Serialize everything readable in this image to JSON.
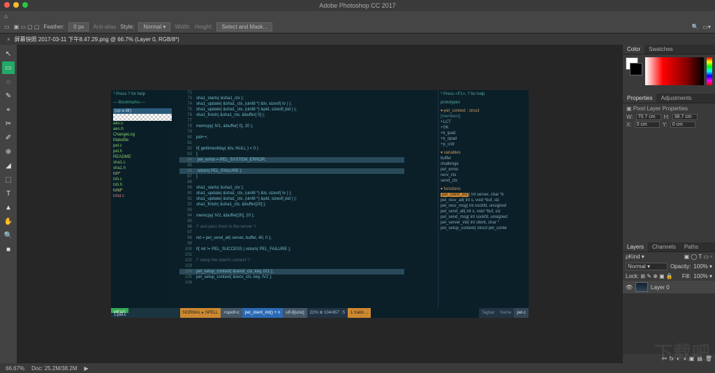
{
  "titlebar": {
    "title": "Adobe Photoshop CC 2017"
  },
  "mac_dots": [
    "#ff5f57",
    "#febc2e",
    "#28c840"
  ],
  "menubar": {
    "items": [
      "▣",
      "▭",
      "⊞",
      "⊡"
    ],
    "feather_label": "Feather:",
    "feather_value": "0 px",
    "antialias": "Anti-alias",
    "style_label": "Style:",
    "style_value": "Normal ▾",
    "width_label": "Width:",
    "height_label": "Height:",
    "select_mask": "Select and Mask..."
  },
  "tab": {
    "close": "×",
    "title": "屏幕快照 2017-03-11 下午8.47.29.png @ 66.7% (Layer 0, RGB/8*)"
  },
  "tools": [
    "↖",
    "▭",
    "◌",
    "✎",
    "⌖",
    "✂",
    "✐",
    "⊕",
    "◢",
    "⬚",
    "T",
    "▲",
    "✋",
    "🔍",
    "■"
  ],
  "editor": {
    "help": "* Press ? for help",
    "bookmarks": "----Bookmarks----",
    "up_dir": "(up a dir)",
    "files": [
      {
        "n": "aes.c",
        "c": "file"
      },
      {
        "n": "aes.h",
        "c": "file"
      },
      {
        "n": "ChangeLog",
        "c": "file"
      },
      {
        "n": "Makefile",
        "c": "file"
      },
      {
        "n": "pel.c",
        "c": "file"
      },
      {
        "n": "pel.h",
        "c": "file"
      },
      {
        "n": "README",
        "c": "file"
      },
      {
        "n": "sha1.c",
        "c": "file"
      },
      {
        "n": "sha1.h",
        "c": "file"
      },
      {
        "n": "tsh*",
        "c": "fy"
      },
      {
        "n": "tsh.c",
        "c": "file"
      },
      {
        "n": "tsh.h",
        "c": "file"
      },
      {
        "n": "tshd*",
        "c": "fy"
      },
      {
        "n": "tshd.c",
        "c": "fr"
      }
    ],
    "code": [
      {
        "ln": 71,
        "t": ""
      },
      {
        "ln": 73,
        "t": "sha1_starts( &sha1_ctx );"
      },
      {
        "ln": 74,
        "t": "sha1_update( &sha1_ctx, (uint8 *) &tv, sizeof( tv ) );"
      },
      {
        "ln": 75,
        "t": "sha1_update( &sha1_ctx, (uint8 *) &pid, sizeof( pid ) );"
      },
      {
        "ln": 76,
        "t": "sha1_finish( &sha1_ctx, &buffer[ 0] );"
      },
      {
        "ln": 77,
        "t": ""
      },
      {
        "ln": 78,
        "t": "memcpy( IV1, &buffer[ 0], 20 );"
      },
      {
        "ln": 79,
        "t": ""
      },
      {
        "ln": 80,
        "t": "pid++;"
      },
      {
        "ln": 81,
        "t": ""
      },
      {
        "ln": 82,
        "t": "if( gettimeofday( &tv, NULL ) < 0 )"
      },
      {
        "ln": 83,
        "t": "{"
      },
      {
        "ln": 84,
        "t": "  pel_errno = PEL_SYSTEM_ERROR;",
        "hl": 1
      },
      {
        "ln": 85,
        "t": ""
      },
      {
        "ln": 86,
        "t": "  return( PEL_FAILURE );",
        "hl": 1
      },
      {
        "ln": 87,
        "t": "}"
      },
      {
        "ln": 88,
        "t": ""
      },
      {
        "ln": 89,
        "t": "sha1_starts( &sha1_ctx );"
      },
      {
        "ln": 90,
        "t": "sha1_update( &sha1_ctx, (uint8 *) &tv, sizeof( tv ) );"
      },
      {
        "ln": 91,
        "t": "sha1_update( &sha1_ctx, (uint8 *) &pid, sizeof( pid ) );"
      },
      {
        "ln": 92,
        "t": "sha1_finish( &sha1_ctx, &buffer[20] );"
      },
      {
        "ln": 93,
        "t": ""
      },
      {
        "ln": 94,
        "t": "memcpy( IV2, &buffer[20], 20 );"
      },
      {
        "ln": 95,
        "t": ""
      },
      {
        "ln": 96,
        "t": "/* and pass them to the server */",
        "cm": 1
      },
      {
        "ln": 97,
        "t": ""
      },
      {
        "ln": 98,
        "t": "ret = pel_send_all( server, buffer, 40, 0 );"
      },
      {
        "ln": 99,
        "t": ""
      },
      {
        "ln": 100,
        "t": "if( ret != PEL_SUCCESS ) return( PEL_FAILURE );"
      },
      {
        "ln": 101,
        "t": ""
      },
      {
        "ln": 102,
        "t": "/* setup the client's context */",
        "cm": 1
      },
      {
        "ln": 103,
        "t": ""
      },
      {
        "ln": 104,
        "t": "pel_setup_context( &send_ctx, key, IV1 );",
        "hl": 1
      },
      {
        "ln": 105,
        "t": "pel_setup_context( &recv_ctx, key, IV2 );"
      },
      {
        "ln": 106,
        "t": ""
      }
    ],
    "right": {
      "help": "* Press <F1>, ? for help",
      "proto": "prototypes",
      "struct_lbl": "▾-pel_context : struct",
      "members": "  [members]",
      "mem_items": [
        "+LCT",
        "+SK",
        "+k_ipad",
        "+k_opad",
        "+p_cntr"
      ],
      "vars": "▾ variables",
      "var_items": [
        "buffer",
        "challenge",
        "pel_errno",
        "recv_ctx",
        "send_ctx"
      ],
      "funcs": "▾ functions",
      "func_sel": "pel_client_init",
      "func_sel_sig": "( int server, char *k",
      "func_items": [
        "pel_recv_all( int s, void *buf, siz",
        "pel_recv_msg( int sockfd, unsigned",
        "pel_send_all( int s, void *buf, siz",
        "pel_send_msg( int sockfd, unsigned",
        "pel_server_init( int client, char *",
        "pel_setup_context( struct pel_conte"
      ]
    },
    "status": {
      "head": "HEAD",
      "mode": "NORMAL ▸ SPELL",
      "git": "<spell>c",
      "fn": "pel_client_init() + n",
      "enc": "utf-8[unix]",
      "pos": "22% ≣ 104/457 : 5",
      "trail": "1 trailin…",
      "taglist": "Tagbar",
      "name": "Name",
      "file": "pel.c",
      "left_label": "1:pel.c"
    }
  },
  "panels": {
    "color_tab": "Color",
    "swatches_tab": "Swatches",
    "fg": "#ffffff",
    "bg": "#000000",
    "properties_tab": "Properties",
    "adjustments_tab": "Adjustments",
    "prop_title": "Pixel Layer Properties",
    "w_label": "W:",
    "w_val": "70.7 cm",
    "h_label": "H:",
    "h_val": "38.7 cm",
    "x_label": "X:",
    "x_val": "0 cm",
    "y_label": "Y:",
    "y_val": "0 cm",
    "layers_tab": "Layers",
    "channels_tab": "Channels",
    "paths_tab": "Paths",
    "kind_label": "ρKind ▾",
    "blend": "Normal ▾",
    "opacity_label": "Opacity:",
    "opacity": "100% ▾",
    "lock_label": "Lock: ⊞ ✎ ⊕ ▣ 🔒",
    "fill_label": "Fill:",
    "fill": "100% ▾",
    "layer0": "Layer 0"
  },
  "footer": {
    "zoom": "66.67%",
    "doc": "Doc: 25.2M/38.2M",
    "arrow": "▶"
  },
  "watermark": "下载吧"
}
